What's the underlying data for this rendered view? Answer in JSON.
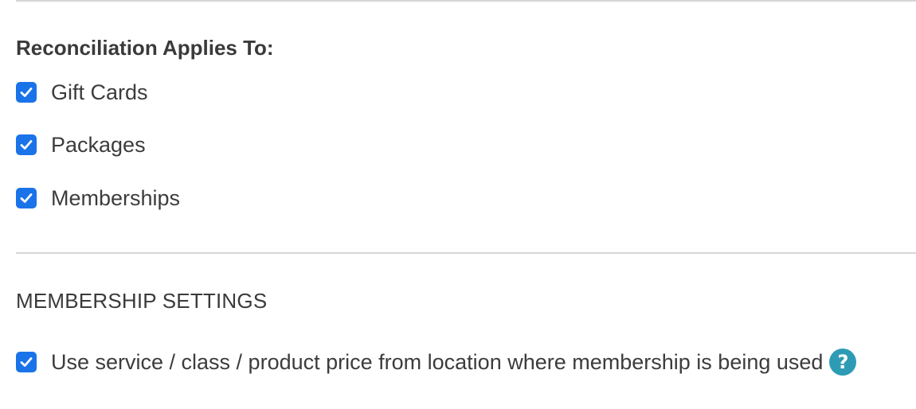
{
  "reconciliation": {
    "heading": "Reconciliation Applies To:",
    "options": [
      {
        "label": "Gift Cards",
        "checked": true
      },
      {
        "label": "Packages",
        "checked": true
      },
      {
        "label": "Memberships",
        "checked": true
      }
    ]
  },
  "membership_settings": {
    "title": "MEMBERSHIP SETTINGS",
    "option": {
      "label": "Use service / class / product price from location where membership is being used",
      "checked": true
    },
    "help_icon": "?"
  },
  "colors": {
    "checkbox_accent": "#1a73e8",
    "help_icon": "#2e9bb5",
    "divider": "#d6d6d6",
    "text": "#3c3c3c"
  },
  "icons": {
    "checkmark": "checkmark-icon",
    "help": "help-icon"
  }
}
